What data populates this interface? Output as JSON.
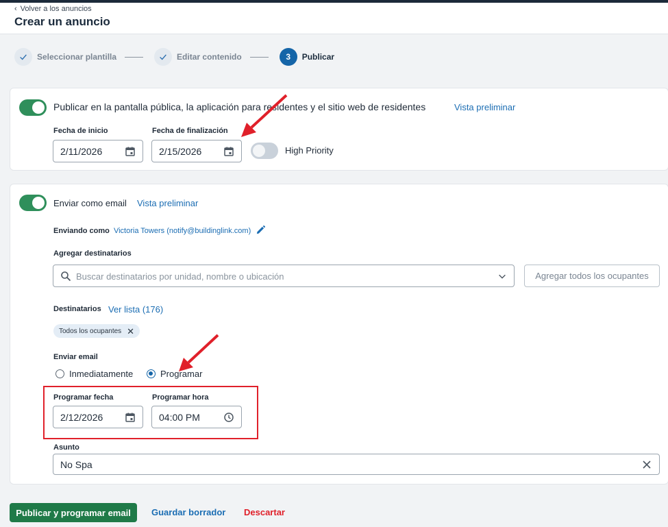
{
  "header": {
    "back_label": "Volver a los anuncios",
    "title": "Crear un anuncio"
  },
  "stepper": {
    "steps": [
      {
        "label": "Seleccionar plantilla",
        "state": "done"
      },
      {
        "label": "Editar contenido",
        "state": "done"
      },
      {
        "label": "Publicar",
        "state": "active",
        "number": "3"
      }
    ]
  },
  "publish_card": {
    "toggle_on": true,
    "label": "Publicar en la pantalla pública, la aplicación para residentes y el sitio web de residentes",
    "preview_link": "Vista preliminar",
    "start_date_label": "Fecha de inicio",
    "start_date_value": "2/11/2026",
    "end_date_label": "Fecha de finalización",
    "end_date_value": "2/15/2026",
    "priority_toggle_on": false,
    "priority_label": "High Priority"
  },
  "email_card": {
    "toggle_on": true,
    "label": "Enviar como email",
    "preview_link": "Vista preliminar",
    "sending_as_label": "Enviando como",
    "sending_as_value": "Victoria Towers (notify@buildinglink.com)",
    "add_recipients_label": "Agregar destinatarios",
    "search_placeholder": "Buscar destinatarios por unidad, nombre o ubicación",
    "add_all_button": "Agregar todos los ocupantes",
    "recipients_label": "Destinatarios",
    "view_list_link": "Ver lista (176)",
    "chips": [
      "Todos los ocupantes"
    ],
    "send_email_label": "Enviar email",
    "send_options": [
      {
        "label": "Inmediatamente",
        "selected": false
      },
      {
        "label": "Programar",
        "selected": true
      }
    ],
    "schedule_date_label": "Programar fecha",
    "schedule_date_value": "2/12/2026",
    "schedule_time_label": "Programar hora",
    "schedule_time_value": "04:00 PM",
    "subject_label": "Asunto",
    "subject_value": "No Spa"
  },
  "actions": {
    "publish_button": "Publicar y programar email",
    "save_draft": "Guardar borrador",
    "discard": "Descartar"
  },
  "colors": {
    "accent": "#1565a8",
    "link": "#1b6db3",
    "primary_button": "#1f7a48",
    "toggle_on": "#2f8f5b",
    "discard": "#e0202a",
    "annotation": "#e0202a"
  }
}
